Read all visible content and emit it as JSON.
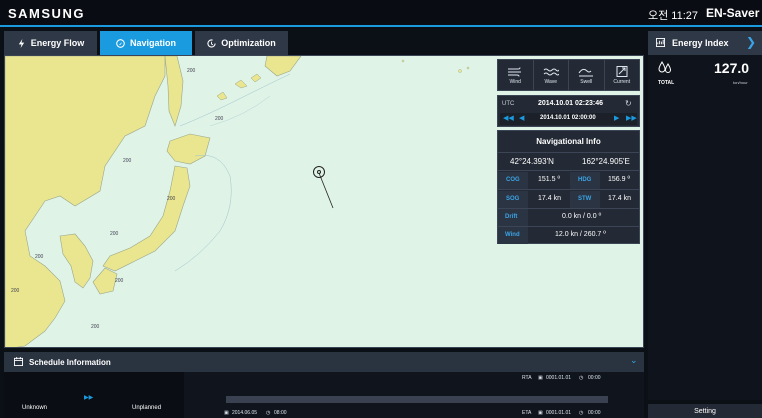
{
  "header": {
    "brand": "SAMSUNG",
    "clock": "오전 11:27",
    "product": "EN-Saver"
  },
  "tabs": [
    {
      "label": "Energy Flow",
      "icon": "lightning-icon"
    },
    {
      "label": "Navigation",
      "icon": "compass-icon",
      "active": true
    },
    {
      "label": "Optimization",
      "icon": "cycle-icon"
    }
  ],
  "map": {
    "depth_labels": [
      "200",
      "200",
      "200",
      "200",
      "200",
      "200",
      "200",
      "200",
      "200"
    ]
  },
  "environment": {
    "buttons": [
      {
        "label": "Wind",
        "icon": "wind-icon"
      },
      {
        "label": "Wave",
        "icon": "wave-icon"
      },
      {
        "label": "Swell",
        "icon": "swell-icon"
      },
      {
        "label": "Current",
        "icon": "current-icon"
      }
    ]
  },
  "time": {
    "utc_label": "UTC",
    "utc_value": "2014.10.01 02:23:46",
    "selected": "2014.10.01 02:00:00"
  },
  "nav_info": {
    "title": "Navigational Info",
    "lat": "42°24.393'N",
    "lon": "162°24.905'E",
    "cog_label": "COG",
    "cog": "151.5 º",
    "hdg_label": "HDG",
    "hdg": "156.9 º",
    "sog_label": "SOG",
    "sog": "17.4 kn",
    "stw_label": "STW",
    "stw": "17.4 kn",
    "drift_label": "Drift",
    "drift": "0.0 kn / 0.0 º",
    "wind_label": "Wind",
    "wind": "12.0 kn / 260.7 º"
  },
  "energy_index": {
    "title": "Energy Index",
    "total_label": "TOTAL",
    "value": "127.0",
    "unit": "ton/hour",
    "setting": "Setting"
  },
  "schedule": {
    "title": "Schedule Information",
    "status_left": "Unknown",
    "status_right": "Unplanned",
    "rta_label": "RTA",
    "rta_date": "0001.01.01",
    "rta_time": "00:00",
    "start_date": "2014.06.05",
    "start_time": "08:00",
    "eta_label": "ETA",
    "eta_date": "0001.01.01",
    "eta_time": "00:00"
  },
  "colors": {
    "accent": "#1a9be0",
    "map_sea": "#dff3e6",
    "map_land": "#eae68f"
  }
}
